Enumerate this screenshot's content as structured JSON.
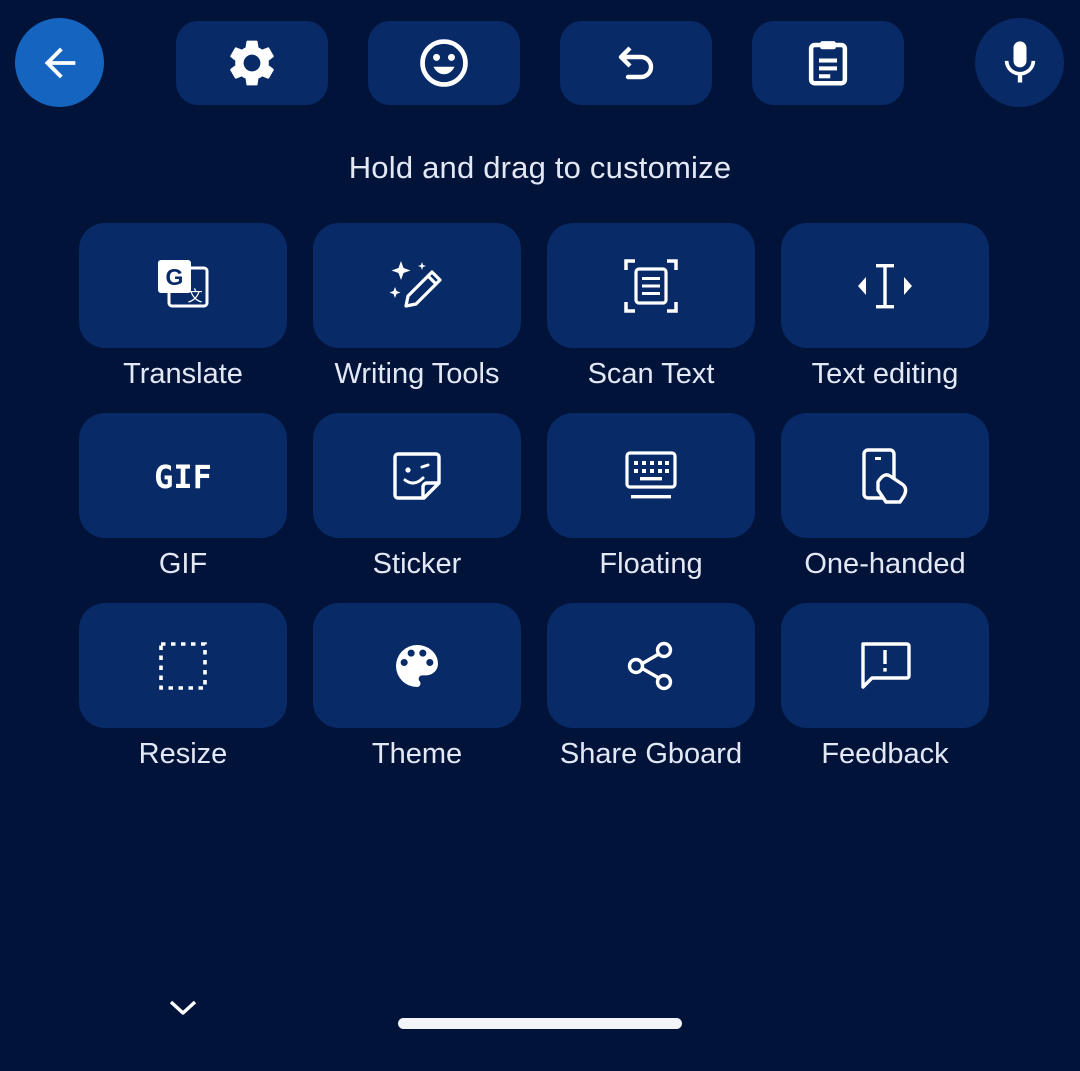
{
  "toolbar": {
    "back": {
      "icon": "arrow-left-icon"
    },
    "buttons": [
      {
        "name": "settings",
        "icon": "gear-icon"
      },
      {
        "name": "emoji",
        "icon": "smiley-icon"
      },
      {
        "name": "undo",
        "icon": "undo-icon"
      },
      {
        "name": "clipboard",
        "icon": "clipboard-icon"
      }
    ],
    "mic": {
      "icon": "microphone-icon"
    }
  },
  "hint": "Hold and drag to customize",
  "tiles": [
    {
      "label": "Translate",
      "icon": "translate-icon"
    },
    {
      "label": "Writing Tools",
      "icon": "magic-pen-icon"
    },
    {
      "label": "Scan Text",
      "icon": "scan-text-icon"
    },
    {
      "label": "Text editing",
      "icon": "text-cursor-icon"
    },
    {
      "label": "GIF",
      "icon": "gif-icon"
    },
    {
      "label": "Sticker",
      "icon": "sticker-icon"
    },
    {
      "label": "Floating",
      "icon": "floating-keyboard-icon"
    },
    {
      "label": "One-handed",
      "icon": "one-handed-icon"
    },
    {
      "label": "Resize",
      "icon": "resize-icon"
    },
    {
      "label": "Theme",
      "icon": "palette-icon"
    },
    {
      "label": "Share Gboard",
      "icon": "share-icon"
    },
    {
      "label": "Feedback",
      "icon": "feedback-icon"
    }
  ],
  "gif_glyph": "GIF",
  "colors": {
    "background": "#02133a",
    "tile": "#082a66",
    "accent": "#1565c0",
    "text": "#e3e8f5"
  }
}
